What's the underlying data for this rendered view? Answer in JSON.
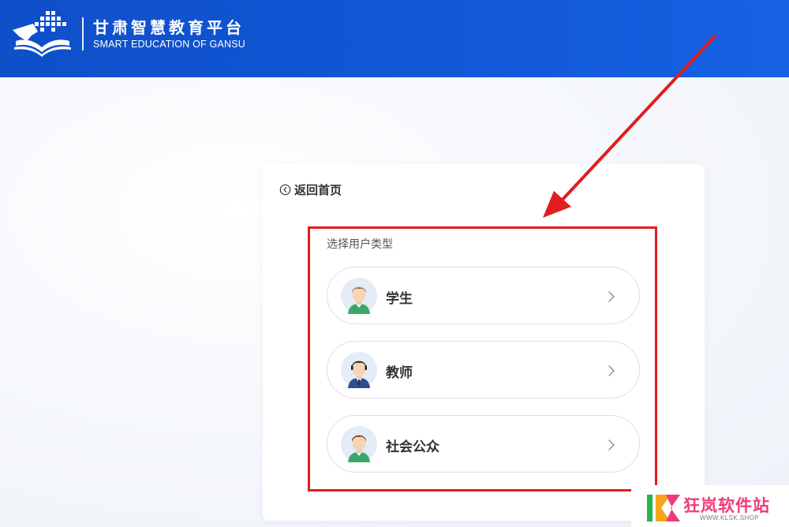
{
  "header": {
    "title": "甘肃智慧教育平台",
    "subtitle": "SMART EDUCATION OF GANSU",
    "logo_icon": "book-grid-logo-icon"
  },
  "card": {
    "back_label": "返回首页",
    "back_icon": "circle-chevron-left-icon",
    "section_title": "选择用户类型",
    "options": [
      {
        "label": "学生",
        "avatar_icon": "student-avatar-icon"
      },
      {
        "label": "教师",
        "avatar_icon": "teacher-avatar-icon"
      },
      {
        "label": "社会公众",
        "avatar_icon": "public-avatar-icon"
      }
    ]
  },
  "annotation": {
    "highlight_color": "#e01e1e",
    "arrow_color": "#e01e1e"
  },
  "watermark": {
    "title": "狂岚软件站",
    "subtitle": "WWW.KLSK.SHOP"
  },
  "colors": {
    "header_blue": "#1157d6",
    "text_dark": "#333333",
    "border": "#dcdfe6"
  }
}
